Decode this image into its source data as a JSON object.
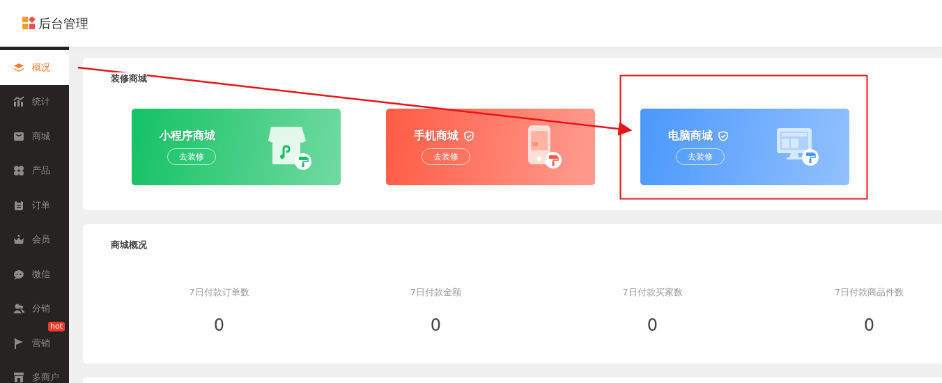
{
  "header": {
    "title": "后台管理"
  },
  "sidebar": {
    "items": [
      {
        "label": "概况",
        "selected": true
      },
      {
        "label": "统计",
        "selected": false
      },
      {
        "label": "商城",
        "selected": false
      },
      {
        "label": "产品",
        "selected": false
      },
      {
        "label": "订单",
        "selected": false
      },
      {
        "label": "会员",
        "selected": false
      },
      {
        "label": "微信",
        "selected": false
      },
      {
        "label": "分销",
        "selected": false
      },
      {
        "label": "营销",
        "selected": false,
        "badge": "hot"
      },
      {
        "label": "多商户",
        "selected": false
      }
    ]
  },
  "decorate": {
    "title": "装修商城",
    "shops": [
      {
        "name": "小程序商城",
        "verified": false,
        "button": "去装修",
        "color": "#13c263"
      },
      {
        "name": "手机商城",
        "verified": true,
        "button": "去装修",
        "color": "#ff5b44"
      },
      {
        "name": "电脑商城",
        "verified": true,
        "button": "去装修",
        "color": "#4a98fc"
      }
    ]
  },
  "overview": {
    "title": "商城概况",
    "stats": [
      {
        "label": "7日付款订单数",
        "value": "0"
      },
      {
        "label": "7日付款金额",
        "value": "0"
      },
      {
        "label": "7日付款买家数",
        "value": "0"
      },
      {
        "label": "7日付款商品件数",
        "value": "0"
      }
    ]
  }
}
